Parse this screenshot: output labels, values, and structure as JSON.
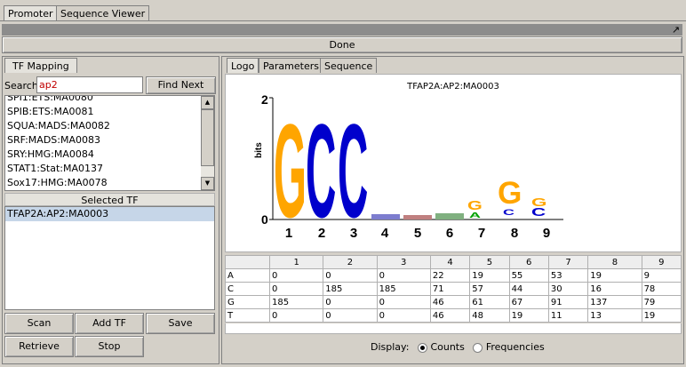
{
  "top_tabs": [
    {
      "label": "Promoter",
      "active": true
    },
    {
      "label": "Sequence Viewer",
      "active": false
    }
  ],
  "done_label": "Done",
  "left": {
    "tab_label": "TF Mapping",
    "search_label": "Search:",
    "search_value": "ap2",
    "find_next_label": "Find Next",
    "tf_list": [
      "SPI1:ETS:MA0080",
      "SPIB:ETS:MA0081",
      "SQUA:MADS:MA0082",
      "SRF:MADS:MA0083",
      "SRY:HMG:MA0084",
      "STAT1:Stat:MA0137",
      "Sox17:HMG:MA0078"
    ],
    "selected_header": "Selected TF",
    "selected_items": [
      "TFAP2A:AP2:MA0003"
    ],
    "buttons": {
      "scan": "Scan",
      "add_tf": "Add TF",
      "save": "Save",
      "retrieve": "Retrieve",
      "stop": "Stop"
    }
  },
  "right": {
    "tabs": [
      {
        "label": "Logo",
        "active": true
      },
      {
        "label": "Parameters",
        "active": false
      },
      {
        "label": "Sequence",
        "active": false
      }
    ],
    "logo_title": "TFAP2A:AP2:MA0003",
    "y_axis_label": "bits",
    "y_ticks": [
      "2",
      "0"
    ],
    "positions": [
      "1",
      "2",
      "3",
      "4",
      "5",
      "6",
      "7",
      "8",
      "9"
    ],
    "matrix": {
      "rows": [
        {
          "base": "A",
          "values": [
            "0",
            "0",
            "0",
            "22",
            "19",
            "55",
            "53",
            "19",
            "9"
          ]
        },
        {
          "base": "C",
          "values": [
            "0",
            "185",
            "185",
            "71",
            "57",
            "44",
            "30",
            "16",
            "78"
          ]
        },
        {
          "base": "G",
          "values": [
            "185",
            "0",
            "0",
            "46",
            "61",
            "67",
            "91",
            "137",
            "79"
          ]
        },
        {
          "base": "T",
          "values": [
            "0",
            "0",
            "0",
            "46",
            "48",
            "19",
            "11",
            "13",
            "19"
          ]
        }
      ]
    },
    "display_label": "Display:",
    "display_options": [
      {
        "label": "Counts",
        "checked": true
      },
      {
        "label": "Frequencies",
        "checked": false
      }
    ]
  },
  "colors": {
    "A": "#00a000",
    "C": "#0000cc",
    "G": "#ffa500",
    "T": "#cc0000"
  }
}
